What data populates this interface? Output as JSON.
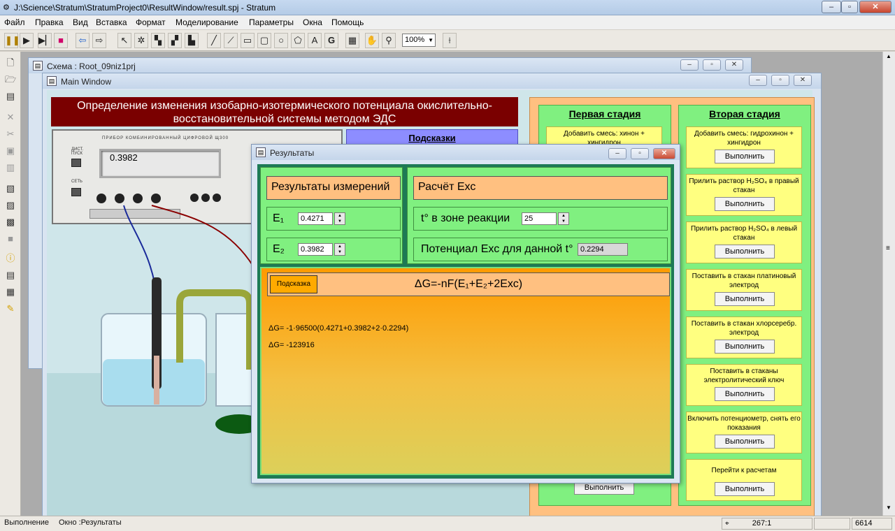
{
  "app": {
    "title": "J:\\Science\\Stratum\\StratumProject0\\ResultWindow/result.spj - Stratum",
    "caption_buttons": {
      "minimize": "–",
      "restore": "▫",
      "close": "✕"
    }
  },
  "menu": [
    "Файл",
    "Правка",
    "Вид",
    "Вставка",
    "Формат",
    "Моделирование",
    "Параметры",
    "Окна",
    "Помощь"
  ],
  "toolbar": {
    "zoom": "100%"
  },
  "schema_window": {
    "title": "Схема : Root_09niz1prj"
  },
  "main_window": {
    "title": "Main Window",
    "header": "Определение изменения изобарно-изотермического потенциала окислительно-восстановительной системы методом ЭДС",
    "hints_button": "Подсказки",
    "device": {
      "label": "ПРИБОР КОМБИНИРОВАННЫЙ ЦИФРОВОЙ Щ300",
      "reading": "0.3982",
      "power": "СЕТЬ",
      "start": "ДИСТ. ПУСК"
    },
    "stage1": {
      "title": "Первая стадия",
      "first_card": "Добавить смесь: хинон + хингидрон",
      "last_button": "Выполнить"
    },
    "stage2": {
      "title": "Вторая стадия",
      "cards": [
        {
          "text": "Добавить смесь: гидрохинон + хингидрон",
          "button": "Выполнить"
        },
        {
          "text": "Прилить раствор H₂SO₄ в правый стакан",
          "button": "Выполнить"
        },
        {
          "text": "Прилить раствор H₂SO₄ в левый стакан",
          "button": "Выполнить"
        },
        {
          "text": "Поставить в стакан платиновый электрод",
          "button": "Выполнить"
        },
        {
          "text": "Поставить в стакан хлорсеребр. электрод",
          "button": "Выполнить"
        },
        {
          "text": "Поставить в стаканы электролитический ключ",
          "button": "Выполнить"
        },
        {
          "text": "Включить потенциометр, снять его показания",
          "button": "Выполнить"
        },
        {
          "text": "Перейти к расчетам",
          "button": "Выполнить"
        }
      ]
    }
  },
  "results_window": {
    "title": "Результаты",
    "measurements_title": "Результаты измерений",
    "e1_label": "E₁",
    "e1_value": "0.4271",
    "e2_label": "E₂",
    "e2_value": "0.3982",
    "calc_title": "Расчёт Eхс",
    "temp_label": "t° в зоне реакции",
    "temp_value": "25",
    "potential_label": "Потенциал Eхс для данной t°",
    "potential_value": "0.2294",
    "hint_button": "Подсказка",
    "formula": "ΔG=-nF(E₁+E₂+2Eхс)",
    "calc_line1": "ΔG= -1·96500(0.4271+0.3982+2·0.2294)",
    "calc_line2": "ΔG= -123916"
  },
  "status": {
    "mode": "Выполнение",
    "window": "Окно :Результаты",
    "coords": "267:1",
    "memory": "6614"
  }
}
